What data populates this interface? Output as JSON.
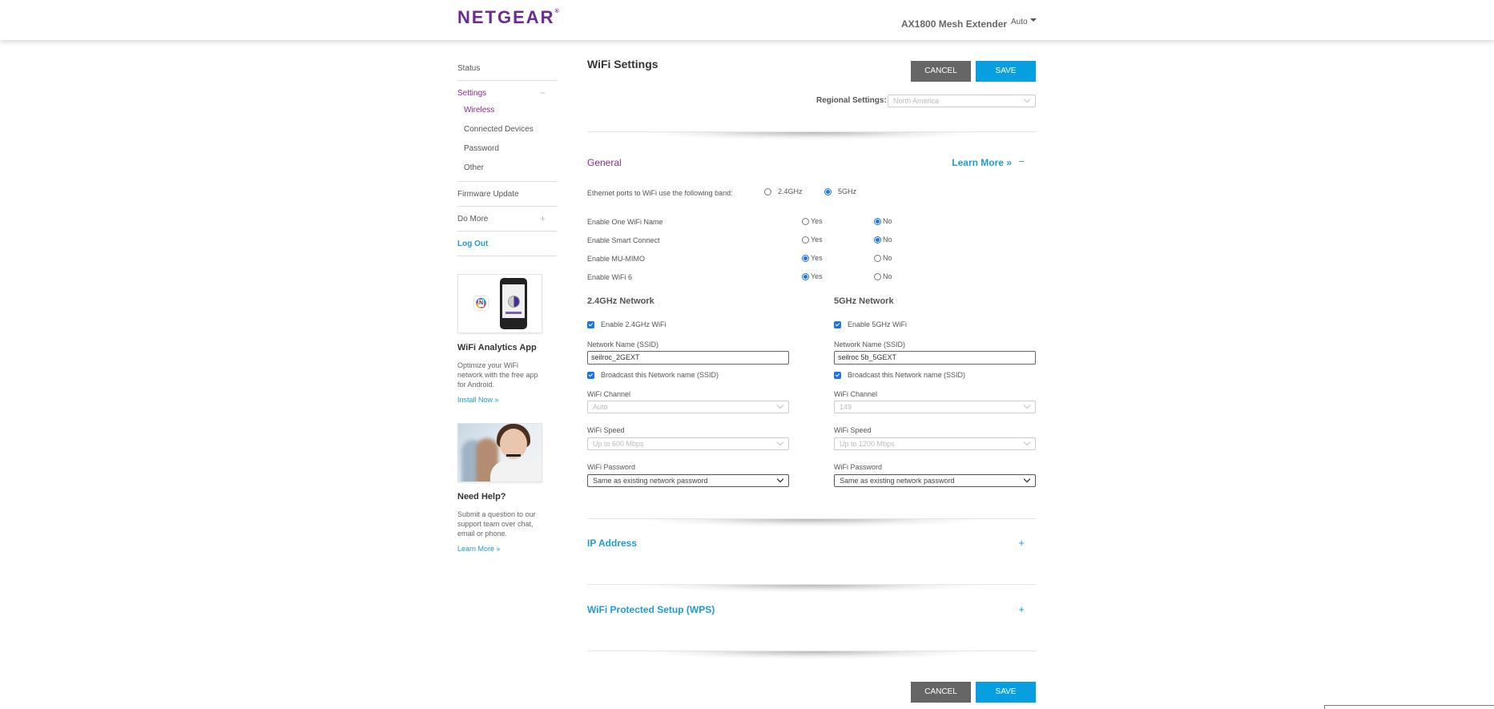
{
  "header": {
    "brand": "NETGEAR",
    "brand_mark": "®",
    "device_name": "AX1800 Mesh Extender",
    "language": "Auto",
    "brand_color": "#6b2c91"
  },
  "sidebar": {
    "items": [
      {
        "label": "Status"
      },
      {
        "label": "Settings",
        "toggle": "−",
        "expanded": true,
        "children": [
          {
            "label": "Wireless",
            "active": true
          },
          {
            "label": "Connected Devices"
          },
          {
            "label": "Password"
          },
          {
            "label": "Other"
          }
        ]
      },
      {
        "label": "Firmware Update"
      },
      {
        "label": "Do More",
        "toggle": "+"
      },
      {
        "label": "Log Out"
      }
    ],
    "promos": [
      {
        "title": "WiFi Analytics App",
        "text": "Optimize your WiFi network with the free app for Android.",
        "link": "Install Now »"
      },
      {
        "title": "Need Help?",
        "text": "Submit a question to our support team over chat, email or phone.",
        "link": "Learn More »"
      }
    ]
  },
  "main": {
    "title": "WiFi Settings",
    "cancel_label": "CANCEL",
    "save_label": "SAVE",
    "regional_label": "Regional Settings:",
    "regional_value": "North America",
    "general": {
      "title": "General",
      "learn_more": "Learn More »",
      "toggle": "−",
      "ethernet_label": "Ethernet ports to WiFi use the following band:",
      "ethernet_options": [
        "2.4GHz",
        "5GHz"
      ],
      "ethernet_selected": "5GHz",
      "options": [
        {
          "label": "Enable One WiFi Name",
          "yes": "Yes",
          "no": "No",
          "value": "No"
        },
        {
          "label": "Enable Smart Connect",
          "yes": "Yes",
          "no": "No",
          "value": "No"
        },
        {
          "label": "Enable MU-MIMO",
          "yes": "Yes",
          "no": "No",
          "value": "Yes"
        },
        {
          "label": "Enable WiFi 6",
          "yes": "Yes",
          "no": "No",
          "value": "Yes"
        }
      ]
    },
    "networks": [
      {
        "title": "2.4GHz Network",
        "enable_label": "Enable 2.4GHz WiFi",
        "enabled": true,
        "ssid_label": "Network Name (SSID)",
        "ssid_value": "seilroc_2GEXT",
        "broadcast_label": "Broadcast this Network name (SSID)",
        "broadcast": true,
        "channel_label": "WiFi Channel",
        "channel_value": "Auto",
        "speed_label": "WiFi Speed",
        "speed_value": "Up to 600 Mbps",
        "password_label": "WiFi Password",
        "password_value": "Same as existing network password"
      },
      {
        "title": "5GHz Network",
        "enable_label": "Enable 5GHz WiFi",
        "enabled": true,
        "ssid_label": "Network Name (SSID)",
        "ssid_value": "seilroc 5b_5GEXT",
        "broadcast_label": "Broadcast this Network name (SSID)",
        "broadcast": true,
        "channel_label": "WiFi Channel",
        "channel_value": "149",
        "speed_label": "WiFi Speed",
        "speed_value": "Up to 1200 Mbps",
        "password_label": "WiFi Password",
        "password_value": "Same as existing network password"
      }
    ],
    "ip_address": {
      "title": "IP Address",
      "toggle": "+"
    },
    "wps": {
      "title": "WiFi Protected Setup (WPS)",
      "toggle": "+"
    },
    "accent_color": "#079fdf",
    "cancel_color": "#666666"
  }
}
